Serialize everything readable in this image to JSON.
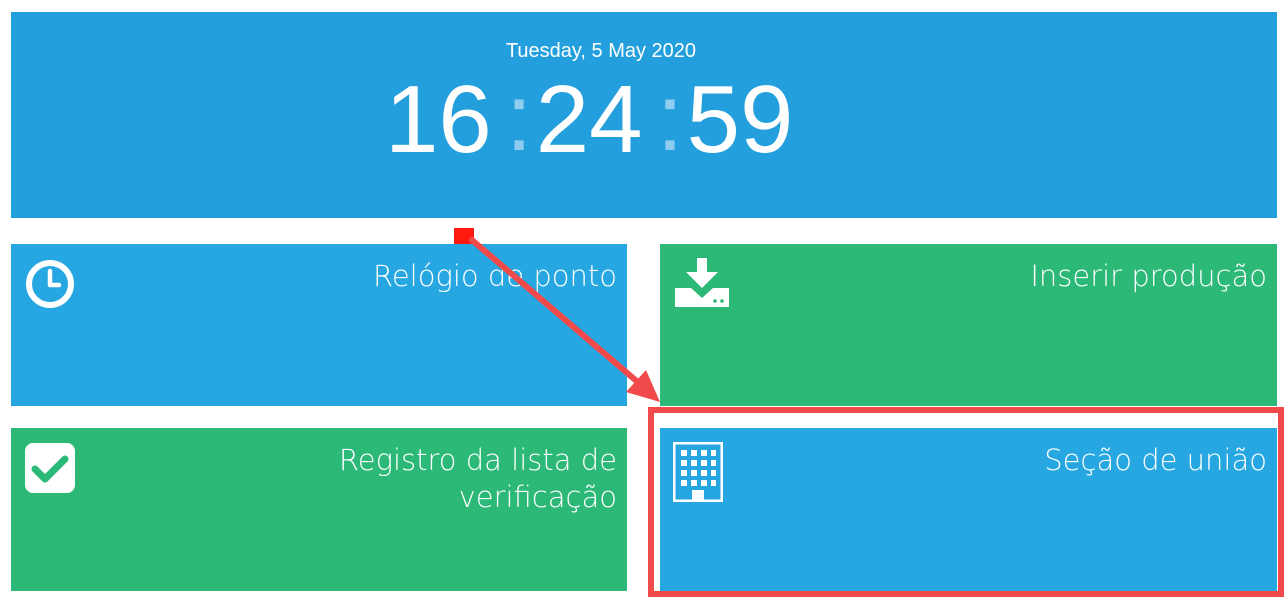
{
  "clock": {
    "date": "Tuesday, 5 May 2020",
    "hours": "16",
    "minutes": "24",
    "seconds": "59",
    "separator": ":"
  },
  "tiles": [
    {
      "label": "Relógio de ponto",
      "icon": "clock-icon",
      "color": "#27a7e2"
    },
    {
      "label": "Inserir produção",
      "icon": "download-tray-icon",
      "color": "#2cb876"
    },
    {
      "label": "Registro da lista de verificação",
      "icon": "checkbox-icon",
      "color": "#2cb876"
    },
    {
      "label": "Seção de união",
      "icon": "building-icon",
      "color": "#27a7e2"
    }
  ],
  "annotation": {
    "highlight_color": "#f24a4a",
    "marker_color": "#ff1a0f"
  }
}
